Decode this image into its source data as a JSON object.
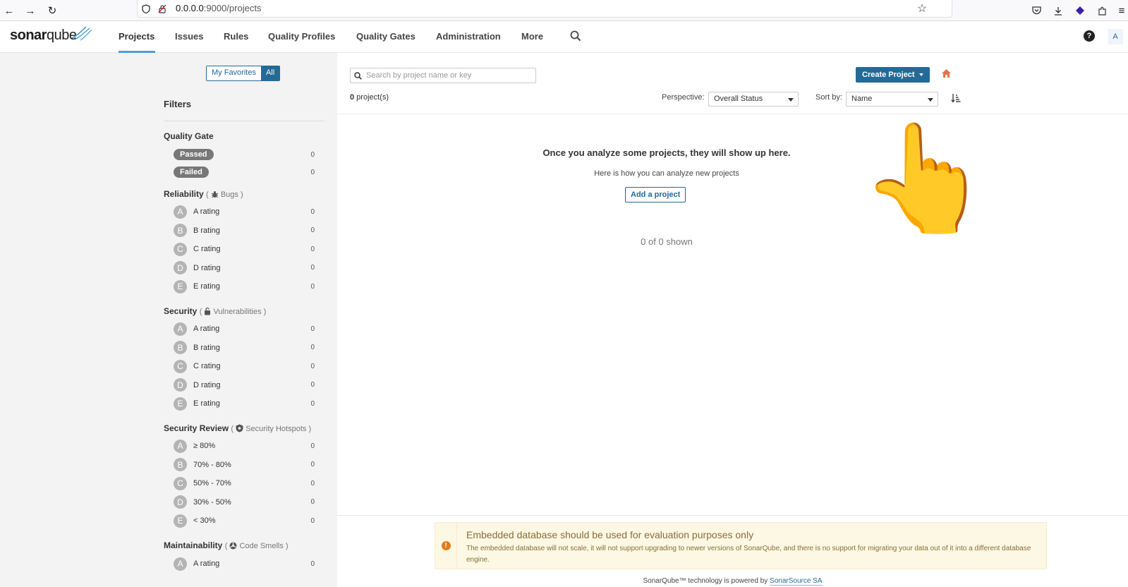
{
  "browser": {
    "url_host": "0.0.0.0",
    "url_path": ":9000/projects"
  },
  "nav": {
    "logo_bold": "sonar",
    "logo_light": "qube",
    "items": [
      "Projects",
      "Issues",
      "Rules",
      "Quality Profiles",
      "Quality Gates",
      "Administration",
      "More"
    ],
    "help": "?",
    "avatar": "A"
  },
  "sidebar": {
    "my_favorites": "My Favorites",
    "all": "All",
    "filters_title": "Filters",
    "quality_gate": {
      "title": "Quality Gate",
      "rows": [
        {
          "label": "Passed",
          "count": "0"
        },
        {
          "label": "Failed",
          "count": "0"
        }
      ]
    },
    "reliability": {
      "title": "Reliability",
      "sub": "Bugs",
      "rows": [
        {
          "letter": "A",
          "label": "A rating",
          "count": "0"
        },
        {
          "letter": "B",
          "label": "B rating",
          "count": "0"
        },
        {
          "letter": "C",
          "label": "C rating",
          "count": "0"
        },
        {
          "letter": "D",
          "label": "D rating",
          "count": "0"
        },
        {
          "letter": "E",
          "label": "E rating",
          "count": "0"
        }
      ]
    },
    "security": {
      "title": "Security",
      "sub": "Vulnerabilities",
      "rows": [
        {
          "letter": "A",
          "label": "A rating",
          "count": "0"
        },
        {
          "letter": "B",
          "label": "B rating",
          "count": "0"
        },
        {
          "letter": "C",
          "label": "C rating",
          "count": "0"
        },
        {
          "letter": "D",
          "label": "D rating",
          "count": "0"
        },
        {
          "letter": "E",
          "label": "E rating",
          "count": "0"
        }
      ]
    },
    "security_review": {
      "title": "Security Review",
      "sub": "Security Hotspots",
      "rows": [
        {
          "letter": "A",
          "label": "≥ 80%",
          "count": "0"
        },
        {
          "letter": "B",
          "label": "70% - 80%",
          "count": "0"
        },
        {
          "letter": "C",
          "label": "50% - 70%",
          "count": "0"
        },
        {
          "letter": "D",
          "label": "30% - 50%",
          "count": "0"
        },
        {
          "letter": "E",
          "label": "< 30%",
          "count": "0"
        }
      ]
    },
    "maintainability": {
      "title": "Maintainability",
      "sub": "Code Smells",
      "rows": [
        {
          "letter": "A",
          "label": "A rating",
          "count": "0"
        }
      ]
    }
  },
  "main": {
    "search_placeholder": "Search by project name or key",
    "create_project": "Create Project",
    "project_count": "0",
    "project_count_suffix": " project(s)",
    "perspective_label": "Perspective:",
    "perspective_value": "Overall Status",
    "sort_label": "Sort by:",
    "sort_value": "Name",
    "empty_title": "Once you analyze some projects, they will show up here.",
    "empty_sub": "Here is how you can analyze new projects",
    "add_project": "Add a project",
    "shown": "0 of 0 shown",
    "hand_emoji": "👆"
  },
  "warning": {
    "title": "Embedded database should be used for evaluation purposes only",
    "text": "The embedded database will not scale, it will not support upgrading to newer versions of SonarQube, and there is no support for migrating your data out of it into a different database engine."
  },
  "footer": {
    "powered_prefix": "SonarQube™ technology is powered by ",
    "powered_link": "SonarSource SA"
  },
  "colors": {
    "accent": "#236a97",
    "sidebar_bg": "#f3f3f3",
    "warning_bg": "#fcf8e3",
    "home_icon": "#e8744a"
  }
}
